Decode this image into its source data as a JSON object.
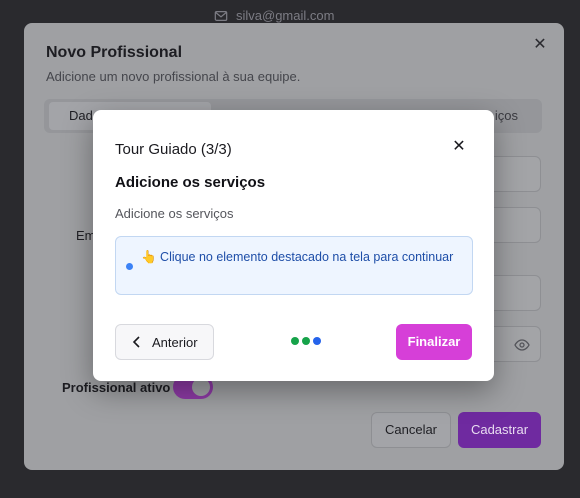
{
  "background": {
    "email": "silva@gmail.com"
  },
  "dialog": {
    "title": "Novo Profissional",
    "subtitle": "Adicione um novo profissional à sua equipe.",
    "tabs": [
      {
        "label": "Dad"
      },
      {
        "label": "iços"
      }
    ],
    "email_label": "Em",
    "ativo_label": "Profissional ativo",
    "ativo_value": true,
    "cancel_label": "Cancelar",
    "submit_label": "Cadastrar"
  },
  "tour": {
    "title": "Tour Guiado (3/3)",
    "heading": "Adicione os serviços",
    "text": "Adicione os serviços",
    "hint": "👆 Clique no elemento destacado na tela para continuar",
    "prev_label": "Anterior",
    "finish_label": "Finalizar",
    "step_current": 3,
    "step_total": 3,
    "dot_colors": [
      "#16a34a",
      "#16a34a",
      "#2563eb"
    ],
    "accent": "#d63fd8"
  }
}
